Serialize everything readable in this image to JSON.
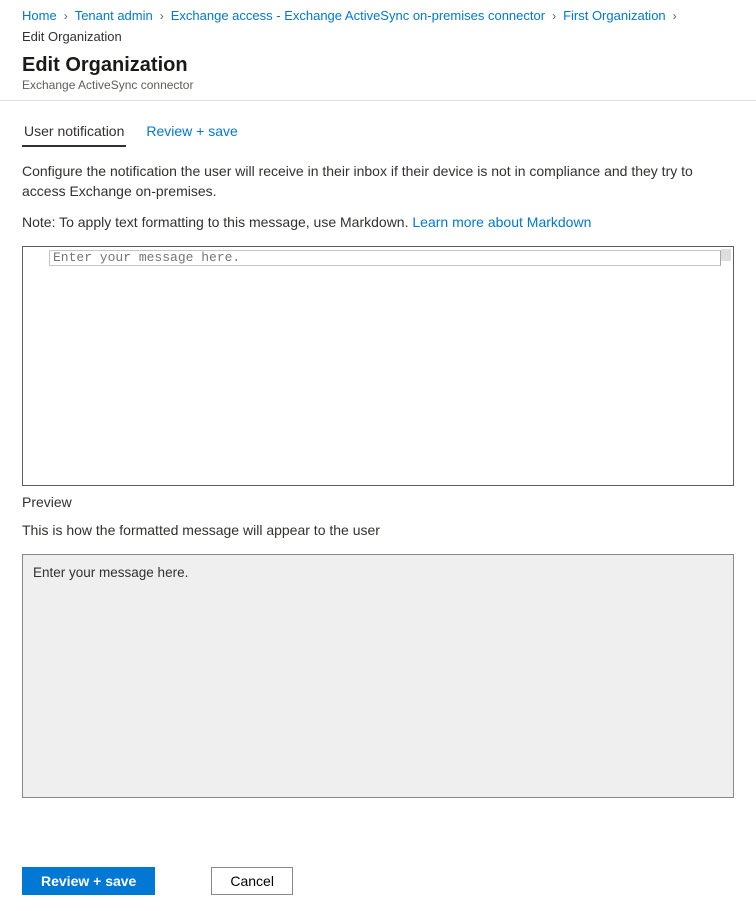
{
  "breadcrumb": {
    "items": [
      {
        "label": "Home"
      },
      {
        "label": "Tenant admin"
      },
      {
        "label": "Exchange access - Exchange ActiveSync on-premises connector"
      },
      {
        "label": "First Organization"
      }
    ],
    "current": "Edit Organization"
  },
  "header": {
    "title": "Edit Organization",
    "subtitle": "Exchange ActiveSync connector"
  },
  "tabs": {
    "items": [
      {
        "label": "User notification",
        "active": true
      },
      {
        "label": "Review + save",
        "active": false
      }
    ]
  },
  "main": {
    "description": "Configure the notification the user will receive in their inbox if their device is not in compliance and they try to access Exchange on-premises.",
    "note_prefix": "Note: To apply text formatting to this message, use Markdown. ",
    "note_link": "Learn more about Markdown",
    "editor_placeholder": "Enter your message here.",
    "preview_label": "Preview",
    "preview_hint": "This is how the formatted message will appear to the user",
    "preview_content": "Enter your message here."
  },
  "footer": {
    "primary_label": "Review + save",
    "cancel_label": "Cancel"
  }
}
